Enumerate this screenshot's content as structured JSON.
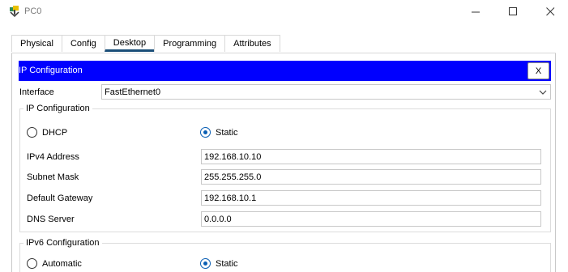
{
  "window": {
    "title": "PC0",
    "app_icon": "packet-tracer-pc-icon",
    "minimize_icon": "minimize-icon",
    "maximize_icon": "maximize-icon",
    "close_icon": "close-icon"
  },
  "tabs": [
    {
      "label": "Physical",
      "active": false
    },
    {
      "label": "Config",
      "active": false
    },
    {
      "label": "Desktop",
      "active": true
    },
    {
      "label": "Programming",
      "active": false
    },
    {
      "label": "Attributes",
      "active": false
    }
  ],
  "ip_config": {
    "header_title": "IP Configuration",
    "close_label": "X",
    "interface_label": "Interface",
    "interface_value": "FastEthernet0",
    "ipv4_group": {
      "legend": "IP Configuration",
      "dhcp_label": "DHCP",
      "static_label": "Static",
      "selected": "Static",
      "ipv4_address_label": "IPv4 Address",
      "ipv4_address_value": "192.168.10.10",
      "subnet_mask_label": "Subnet Mask",
      "subnet_mask_value": "255.255.255.0",
      "default_gateway_label": "Default Gateway",
      "default_gateway_value": "192.168.10.1",
      "dns_server_label": "DNS Server",
      "dns_server_value": "0.0.0.0"
    },
    "ipv6_group": {
      "legend": "IPv6 Configuration",
      "automatic_label": "Automatic",
      "static_label": "Static",
      "selected": "Static"
    }
  },
  "colors": {
    "header_bg": "#0000ff",
    "active_tab_underline": "#1a4e78",
    "radio_accent": "#0a5fb4"
  }
}
